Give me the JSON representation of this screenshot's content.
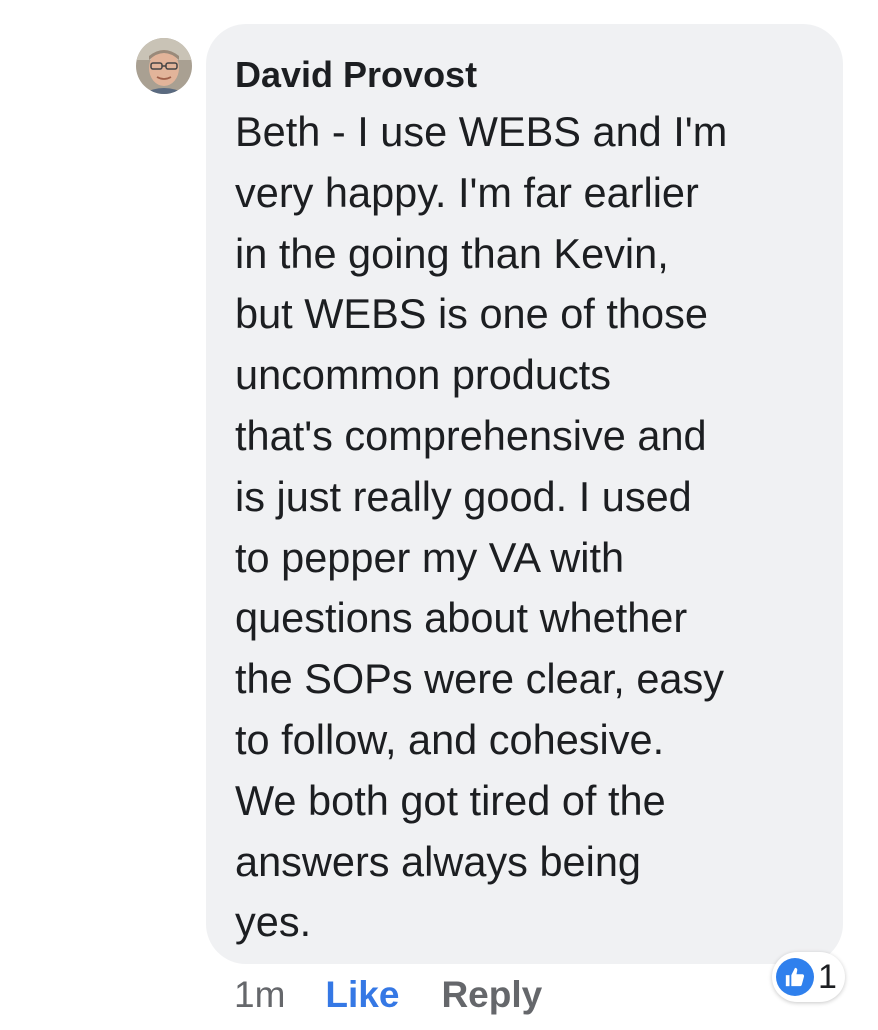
{
  "comment": {
    "author": "David Provost",
    "avatar": "profile-photo",
    "text": "Beth - I use WEBS and I'm\nvery happy. I'm far earlier\nin the going than Kevin,\nbut WEBS is one of those\nuncommon products\nthat's comprehensive and\nis just really good. I used\nto pepper my VA with\nquestions about whether\nthe SOPs were clear, easy\nto follow, and cohesive.\nWe both got tired of the\nanswers always being\nyes.",
    "time": "1m",
    "like_label": "Like",
    "reply_label": "Reply",
    "reaction": {
      "icon": "thumbs-up-icon",
      "count": "1"
    }
  },
  "colors": {
    "bubble_bg": "#f0f1f3",
    "link_blue": "#3578e5",
    "muted_gray": "#65676b",
    "text": "#1c1e21",
    "like_badge": "#2f80ed"
  }
}
